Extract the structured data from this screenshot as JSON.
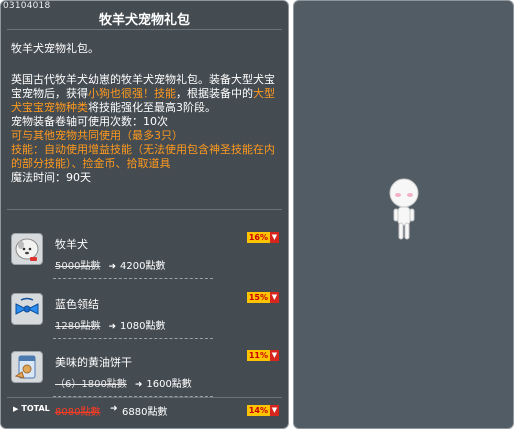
{
  "header": {
    "item_id": "03104018",
    "title": "牧羊犬宠物礼包"
  },
  "description": {
    "line1": "牧羊犬宠物礼包。",
    "para_pre1": "英国古代牧羊犬幼崽的牧羊犬宠物礼包。装备大型犬宝宝宠物后，获得",
    "para_hl1": "小狗也很强！技能",
    "para_mid1": "，根据装备中的",
    "para_hl2": "大型犬宝宝宠物种类",
    "para_post": "将技能强化至最高3阶段。",
    "scroll_count": "宠物装备卷轴可使用次数：10次",
    "share_note": "可与其他宠物共同使用（最多3只）",
    "skills": "技能：自动使用增益技能（无法使用包含神圣技能在内的部分技能）、捡金币、拾取道具",
    "magic_time": "魔法时间：90天"
  },
  "items": [
    {
      "name": "牧羊犬",
      "old_price": "5000點數",
      "new_price": "4200點數",
      "discount": "16%",
      "icon": "dog-icon"
    },
    {
      "name": "蓝色领结",
      "old_price": "1280點數",
      "new_price": "1080點數",
      "discount": "15%",
      "icon": "bow-tie-icon"
    },
    {
      "name": "美味的黄油饼干",
      "old_price": "（6）1800點數",
      "new_price": "1600點數",
      "discount": "11%",
      "icon": "cookie-bag-icon"
    }
  ],
  "total": {
    "label": "TOTAL",
    "old_price": "8080點數",
    "new_price": "6880點數",
    "discount": "14%"
  },
  "icons": {
    "down": "down-arrow-icon",
    "arrow": "right-arrow-icon",
    "avatar": "character-avatar-icon"
  },
  "colors": {
    "panel_bg": "#444b51",
    "preview_bg": "#525c64",
    "highlight": "#ff9a1e",
    "badge_bg": "#ffc400",
    "badge_down": "#d7261e",
    "total_old": "#ff3b22"
  }
}
